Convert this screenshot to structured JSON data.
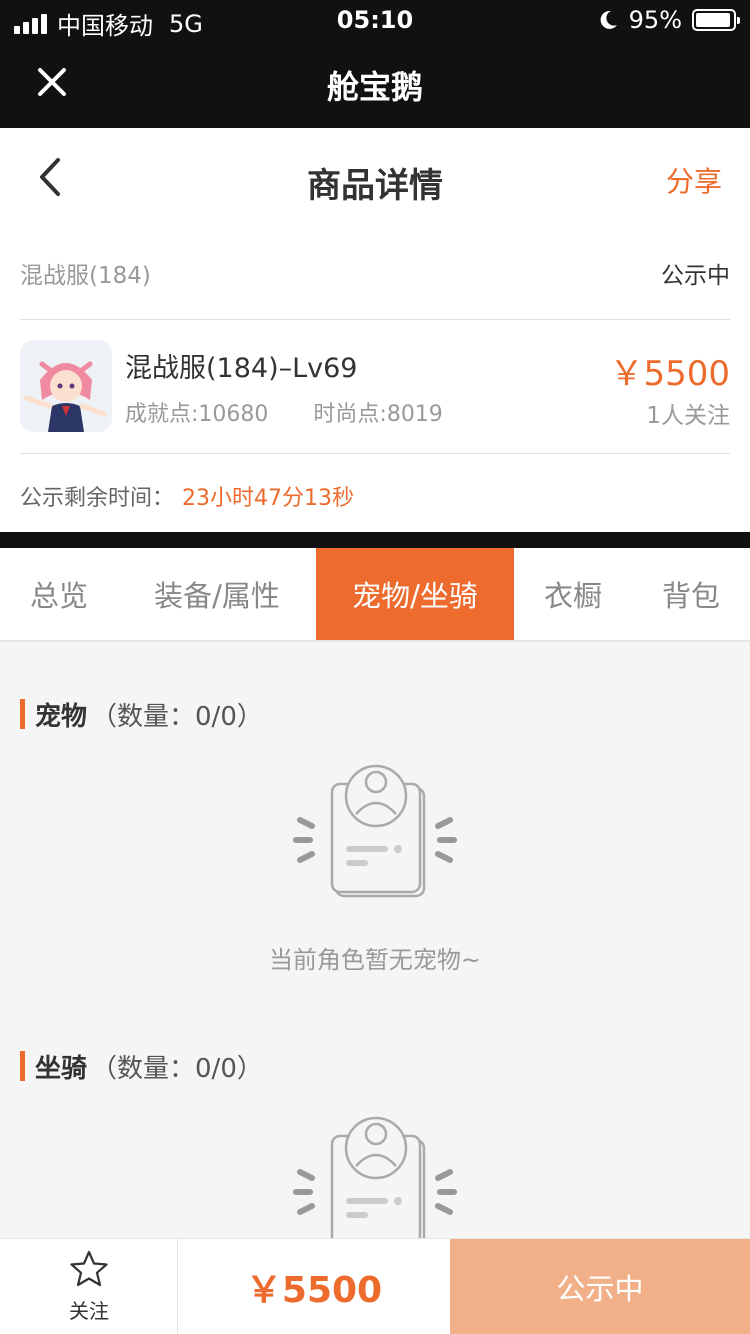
{
  "status_bar": {
    "carrier": "中国移动",
    "network": "5G",
    "time": "05:10",
    "battery": "95%"
  },
  "app": {
    "title": "舱宝鹅",
    "close_icon": "close-icon"
  },
  "nav": {
    "title": "商品详情",
    "share_label": "分享",
    "back_icon": "chevron-left-icon"
  },
  "product": {
    "server": "混战服(184)",
    "status": "公示中",
    "name": "混战服(184)–Lv69",
    "achievement": "成就点:10680",
    "fashion": "时尚点:8019",
    "price": "￥5500",
    "followers": "1人关注",
    "time_label": "公示剩余时间：",
    "time_remaining": "23小时47分13秒"
  },
  "tabs": [
    {
      "label": "总览",
      "active": false
    },
    {
      "label": "装备/属性",
      "active": false
    },
    {
      "label": "宠物/坐骑",
      "active": true
    },
    {
      "label": "衣橱",
      "active": false
    },
    {
      "label": "背包",
      "active": false
    }
  ],
  "pets": {
    "title": "宠物",
    "count": "（数量：0/0）",
    "empty_text": "当前角色暂无宠物~"
  },
  "mounts": {
    "title": "坐骑",
    "count": "（数量：0/0）"
  },
  "bottom": {
    "follow_label": "关注",
    "price": "￥5500",
    "action_label": "公示中"
  },
  "colors": {
    "accent": "#ec6b2d",
    "accent_light": "#f2b088",
    "header_bg": "#111111"
  }
}
